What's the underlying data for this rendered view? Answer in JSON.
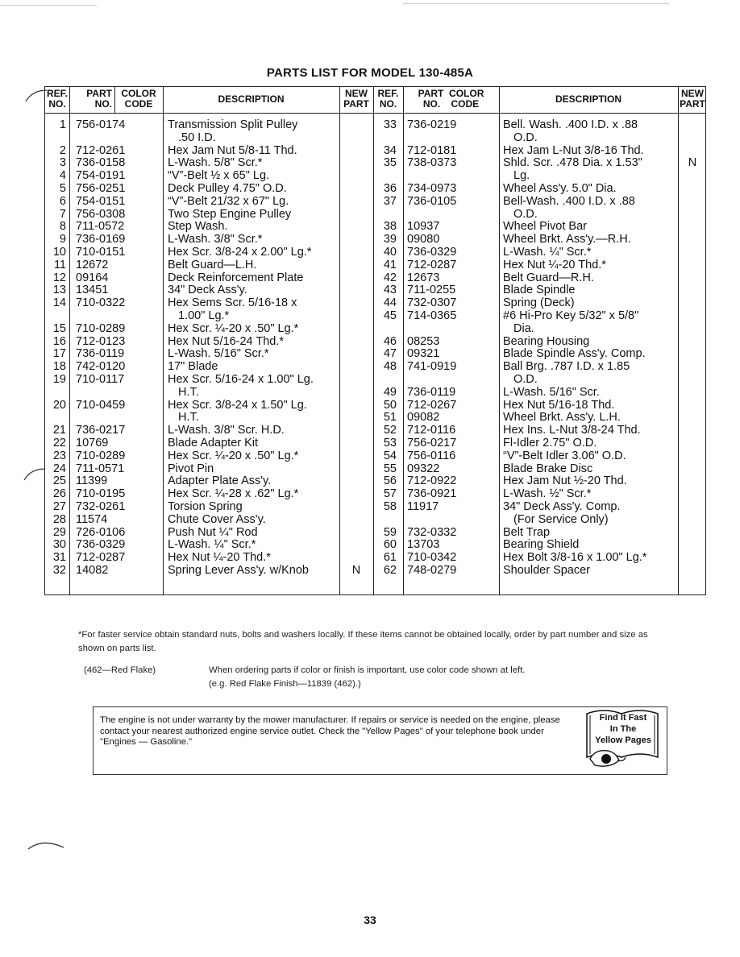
{
  "title": "PARTS LIST FOR MODEL 130-485A",
  "headers": {
    "ref_no": [
      "REF.",
      "NO."
    ],
    "part_no": [
      "PART",
      "NO."
    ],
    "color_code": [
      "COLOR",
      "CODE"
    ],
    "description": "DESCRIPTION",
    "new_part": [
      "NEW",
      "PART"
    ]
  },
  "left_rows": [
    {
      "ref": "1",
      "part": "756-0174",
      "desc": [
        "Transmission Split Pulley",
        ".50 I.D."
      ],
      "new": ""
    },
    {
      "ref": "2",
      "part": "712-0261",
      "desc": [
        "Hex Jam Nut 5/8-11 Thd."
      ],
      "new": ""
    },
    {
      "ref": "3",
      "part": "736-0158",
      "desc": [
        "L-Wash. 5/8\" Scr.*"
      ],
      "new": ""
    },
    {
      "ref": "4",
      "part": "754-0191",
      "desc": [
        "“V”-Belt ½ x 65\" Lg."
      ],
      "new": ""
    },
    {
      "ref": "5",
      "part": "756-0251",
      "desc": [
        "Deck Pulley 4.75\" O.D."
      ],
      "new": ""
    },
    {
      "ref": "6",
      "part": "754-0151",
      "desc": [
        "“V”-Belt 21/32 x 67\" Lg."
      ],
      "new": ""
    },
    {
      "ref": "7",
      "part": "756-0308",
      "desc": [
        "Two Step Engine Pulley"
      ],
      "new": ""
    },
    {
      "ref": "8",
      "part": "711-0572",
      "desc": [
        "Step Wash."
      ],
      "new": ""
    },
    {
      "ref": "9",
      "part": "736-0169",
      "desc": [
        "L-Wash. 3/8\" Scr.*"
      ],
      "new": ""
    },
    {
      "ref": "10",
      "part": "710-0151",
      "desc": [
        "Hex Scr. 3/8-24 x 2.00\" Lg.*"
      ],
      "new": ""
    },
    {
      "ref": "11",
      "part": "12672",
      "desc": [
        "Belt Guard—L.H."
      ],
      "new": ""
    },
    {
      "ref": "12",
      "part": "09164",
      "desc": [
        "Deck Reinforcement Plate"
      ],
      "new": ""
    },
    {
      "ref": "13",
      "part": "13451",
      "desc": [
        "34\" Deck Ass'y."
      ],
      "new": ""
    },
    {
      "ref": "14",
      "part": "710-0322",
      "desc": [
        "Hex Sems Scr. 5/16-18 x",
        "1.00\" Lg.*"
      ],
      "new": ""
    },
    {
      "ref": "15",
      "part": "710-0289",
      "desc": [
        "Hex Scr. ¼-20 x .50\" Lg.*"
      ],
      "new": ""
    },
    {
      "ref": "16",
      "part": "712-0123",
      "desc": [
        "Hex Nut 5/16-24 Thd.*"
      ],
      "new": ""
    },
    {
      "ref": "17",
      "part": "736-0119",
      "desc": [
        "L-Wash. 5/16\" Scr.*"
      ],
      "new": ""
    },
    {
      "ref": "18",
      "part": "742-0120",
      "desc": [
        "17\" Blade"
      ],
      "new": ""
    },
    {
      "ref": "19",
      "part": "710-0117",
      "desc": [
        "Hex Scr. 5/16-24 x 1.00\" Lg.",
        "H.T."
      ],
      "new": ""
    },
    {
      "ref": "20",
      "part": "710-0459",
      "desc": [
        "Hex Scr. 3/8-24 x 1.50\" Lg.",
        "H.T."
      ],
      "new": ""
    },
    {
      "ref": "21",
      "part": "736-0217",
      "desc": [
        "L-Wash. 3/8\" Scr. H.D."
      ],
      "new": ""
    },
    {
      "ref": "22",
      "part": "10769",
      "desc": [
        "Blade Adapter Kit"
      ],
      "new": ""
    },
    {
      "ref": "23",
      "part": "710-0289",
      "desc": [
        "Hex Scr. ¼-20 x .50\" Lg.*"
      ],
      "new": ""
    },
    {
      "ref": "24",
      "part": "711-0571",
      "desc": [
        "Pivot Pin"
      ],
      "new": ""
    },
    {
      "ref": "25",
      "part": "11399",
      "desc": [
        "Adapter Plate Ass'y."
      ],
      "new": ""
    },
    {
      "ref": "26",
      "part": "710-0195",
      "desc": [
        "Hex Scr. ¼-28 x .62\" Lg.*"
      ],
      "new": ""
    },
    {
      "ref": "27",
      "part": "732-0261",
      "desc": [
        "Torsion Spring"
      ],
      "new": ""
    },
    {
      "ref": "28",
      "part": "11574",
      "desc": [
        "Chute Cover Ass'y."
      ],
      "new": ""
    },
    {
      "ref": "29",
      "part": "726-0106",
      "desc": [
        "Push Nut ¼\" Rod"
      ],
      "new": ""
    },
    {
      "ref": "30",
      "part": "736-0329",
      "desc": [
        "L-Wash. ¼\" Scr.*"
      ],
      "new": ""
    },
    {
      "ref": "31",
      "part": "712-0287",
      "desc": [
        "Hex Nut ¼-20 Thd.*"
      ],
      "new": ""
    },
    {
      "ref": "32",
      "part": "14082",
      "desc": [
        "Spring Lever Ass'y. w/Knob"
      ],
      "new": "N"
    }
  ],
  "right_rows": [
    {
      "ref": "33",
      "part": "736-0219",
      "desc": [
        "Bell. Wash. .400 I.D. x .88",
        "O.D."
      ],
      "new": ""
    },
    {
      "ref": "34",
      "part": "712-0181",
      "desc": [
        "Hex Jam L-Nut 3/8-16 Thd."
      ],
      "new": ""
    },
    {
      "ref": "35",
      "part": "738-0373",
      "desc": [
        "Shld. Scr. .478 Dia. x 1.53\"",
        "Lg."
      ],
      "new": "N"
    },
    {
      "ref": "36",
      "part": "734-0973",
      "desc": [
        "Wheel Ass'y. 5.0\" Dia."
      ],
      "new": ""
    },
    {
      "ref": "37",
      "part": "736-0105",
      "desc": [
        "Bell-Wash. .400 I.D. x .88",
        "O.D."
      ],
      "new": ""
    },
    {
      "ref": "38",
      "part": "10937",
      "desc": [
        "Wheel Pivot Bar"
      ],
      "new": ""
    },
    {
      "ref": "39",
      "part": "09080",
      "desc": [
        "Wheel Brkt. Ass'y.—R.H."
      ],
      "new": ""
    },
    {
      "ref": "40",
      "part": "736-0329",
      "desc": [
        "L-Wash. ¼\" Scr.*"
      ],
      "new": ""
    },
    {
      "ref": "41",
      "part": "712-0287",
      "desc": [
        "Hex Nut ¼-20 Thd.*"
      ],
      "new": ""
    },
    {
      "ref": "42",
      "part": "12673",
      "desc": [
        "Belt Guard—R.H."
      ],
      "new": ""
    },
    {
      "ref": "43",
      "part": "711-0255",
      "desc": [
        "Blade Spindle"
      ],
      "new": ""
    },
    {
      "ref": "44",
      "part": "732-0307",
      "desc": [
        "Spring (Deck)"
      ],
      "new": ""
    },
    {
      "ref": "45",
      "part": "714-0365",
      "desc": [
        "#6 Hi-Pro Key 5/32\" x 5/8\"",
        "Dia."
      ],
      "new": ""
    },
    {
      "ref": "46",
      "part": "08253",
      "desc": [
        "Bearing Housing"
      ],
      "new": ""
    },
    {
      "ref": "47",
      "part": "09321",
      "desc": [
        "Blade Spindle Ass'y. Comp."
      ],
      "new": ""
    },
    {
      "ref": "48",
      "part": "741-0919",
      "desc": [
        "Ball Brg. .787 I.D. x 1.85",
        "O.D."
      ],
      "new": ""
    },
    {
      "ref": "49",
      "part": "736-0119",
      "desc": [
        "L-Wash. 5/16\" Scr."
      ],
      "new": ""
    },
    {
      "ref": "50",
      "part": "712-0267",
      "desc": [
        "Hex Nut 5/16-18 Thd."
      ],
      "new": ""
    },
    {
      "ref": "51",
      "part": "09082",
      "desc": [
        "Wheel Brkt. Ass'y. L.H."
      ],
      "new": ""
    },
    {
      "ref": "52",
      "part": "712-0116",
      "desc": [
        "Hex Ins. L-Nut 3/8-24 Thd."
      ],
      "new": ""
    },
    {
      "ref": "53",
      "part": "756-0217",
      "desc": [
        "Fl-Idler 2.75\" O.D."
      ],
      "new": ""
    },
    {
      "ref": "54",
      "part": "756-0116",
      "desc": [
        "“V”-Belt Idler 3.06\" O.D."
      ],
      "new": ""
    },
    {
      "ref": "55",
      "part": "09322",
      "desc": [
        "Blade Brake Disc"
      ],
      "new": ""
    },
    {
      "ref": "56",
      "part": "712-0922",
      "desc": [
        "Hex Jam Nut ½-20 Thd."
      ],
      "new": ""
    },
    {
      "ref": "57",
      "part": "736-0921",
      "desc": [
        "L-Wash. ½\" Scr.*"
      ],
      "new": ""
    },
    {
      "ref": "58",
      "part": "11917",
      "desc": [
        "34\" Deck Ass'y. Comp.",
        "(For Service Only)"
      ],
      "new": ""
    },
    {
      "ref": "59",
      "part": "732-0332",
      "desc": [
        "Belt Trap"
      ],
      "new": ""
    },
    {
      "ref": "60",
      "part": "13703",
      "desc": [
        "Bearing Shield"
      ],
      "new": ""
    },
    {
      "ref": "61",
      "part": "710-0342",
      "desc": [
        "Hex Bolt 3/8-16 x 1.00\" Lg.*"
      ],
      "new": ""
    },
    {
      "ref": "62",
      "part": "748-0279",
      "desc": [
        "Shoulder Spacer"
      ],
      "new": ""
    }
  ],
  "footnotes": {
    "service_note": "*For faster service obtain standard nuts, bolts and washers locally. If these items cannot be obtained locally, order by part number and size as shown on parts list.",
    "color_code_label": "(462—Red Flake)",
    "color_code_note_1": "When ordering parts if color or finish is important, use color code shown at left.",
    "color_code_note_2": "(e.g. Red Flake Finish—11839 (462).)"
  },
  "warranty_box": {
    "text": "The engine is not under warranty by the mower manufacturer. If repairs or service is needed on the engine, please contact your nearest authorized engine service outlet. Check the \"Yellow Pages\" of your telephone book under \"Engines — Gasoline.\"",
    "badge_lines": [
      "Find It Fast",
      "In The",
      "Yellow Pages"
    ]
  },
  "page_number": "33"
}
